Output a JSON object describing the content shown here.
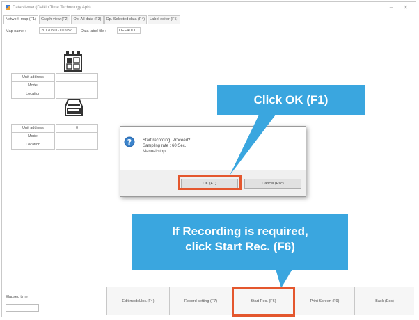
{
  "window": {
    "title": "Data viewer (Daikin Time Technology Apb)",
    "minimize_glyph": "–",
    "close_glyph": "✕",
    "app_icon": "app-icon"
  },
  "tabs": [
    {
      "label": "Network map (F1)",
      "active": true
    },
    {
      "label": "Graph view (F2)",
      "active": false
    },
    {
      "label": "Op. All data (F3)",
      "active": false
    },
    {
      "label": "Op. Selected data (F4)",
      "active": false
    },
    {
      "label": "Label editor (F5)",
      "active": false
    }
  ],
  "map": {
    "name_label": "Map name :",
    "name_value": "20170511-110932",
    "data_label_label": "Data label file :",
    "data_label_value": "DEFAULT"
  },
  "units": [
    {
      "icon": "controller-icon",
      "rows": [
        {
          "label": "Unit address",
          "value": ""
        },
        {
          "label": "Model",
          "value": ""
        },
        {
          "label": "Location",
          "value": ""
        }
      ]
    },
    {
      "icon": "outdoor-unit-icon",
      "rows": [
        {
          "label": "Unit address",
          "value": "0"
        },
        {
          "label": "Model",
          "value": ""
        },
        {
          "label": "Location",
          "value": ""
        }
      ]
    }
  ],
  "dialog": {
    "icon": "question-icon",
    "line1": "Start recording. Proceed?",
    "line2": "Sampling rate : 60 Sec.",
    "line3": "Manual stop",
    "ok_label": "OK (F1)",
    "cancel_label": "Cancel (Esc)"
  },
  "callouts": {
    "ok": "Click OK (F1)",
    "rec_line1": "If Recording is required,",
    "rec_line2": "click Start Rec. (F6)"
  },
  "toolbar": {
    "elapsed_label": "Elapsed time",
    "elapsed_value": "",
    "buttons": [
      {
        "label": "Edit model/loc.(F4)"
      },
      {
        "label": "Record setting (F7)"
      },
      {
        "label": "Start Rec. (F6)"
      },
      {
        "label": "Print Screen (F9)"
      },
      {
        "label": "Back (Esc)"
      }
    ]
  },
  "colors": {
    "callout": "#3aa6df",
    "highlight": "#e4572e",
    "question_icon": "#2f6fb5"
  }
}
